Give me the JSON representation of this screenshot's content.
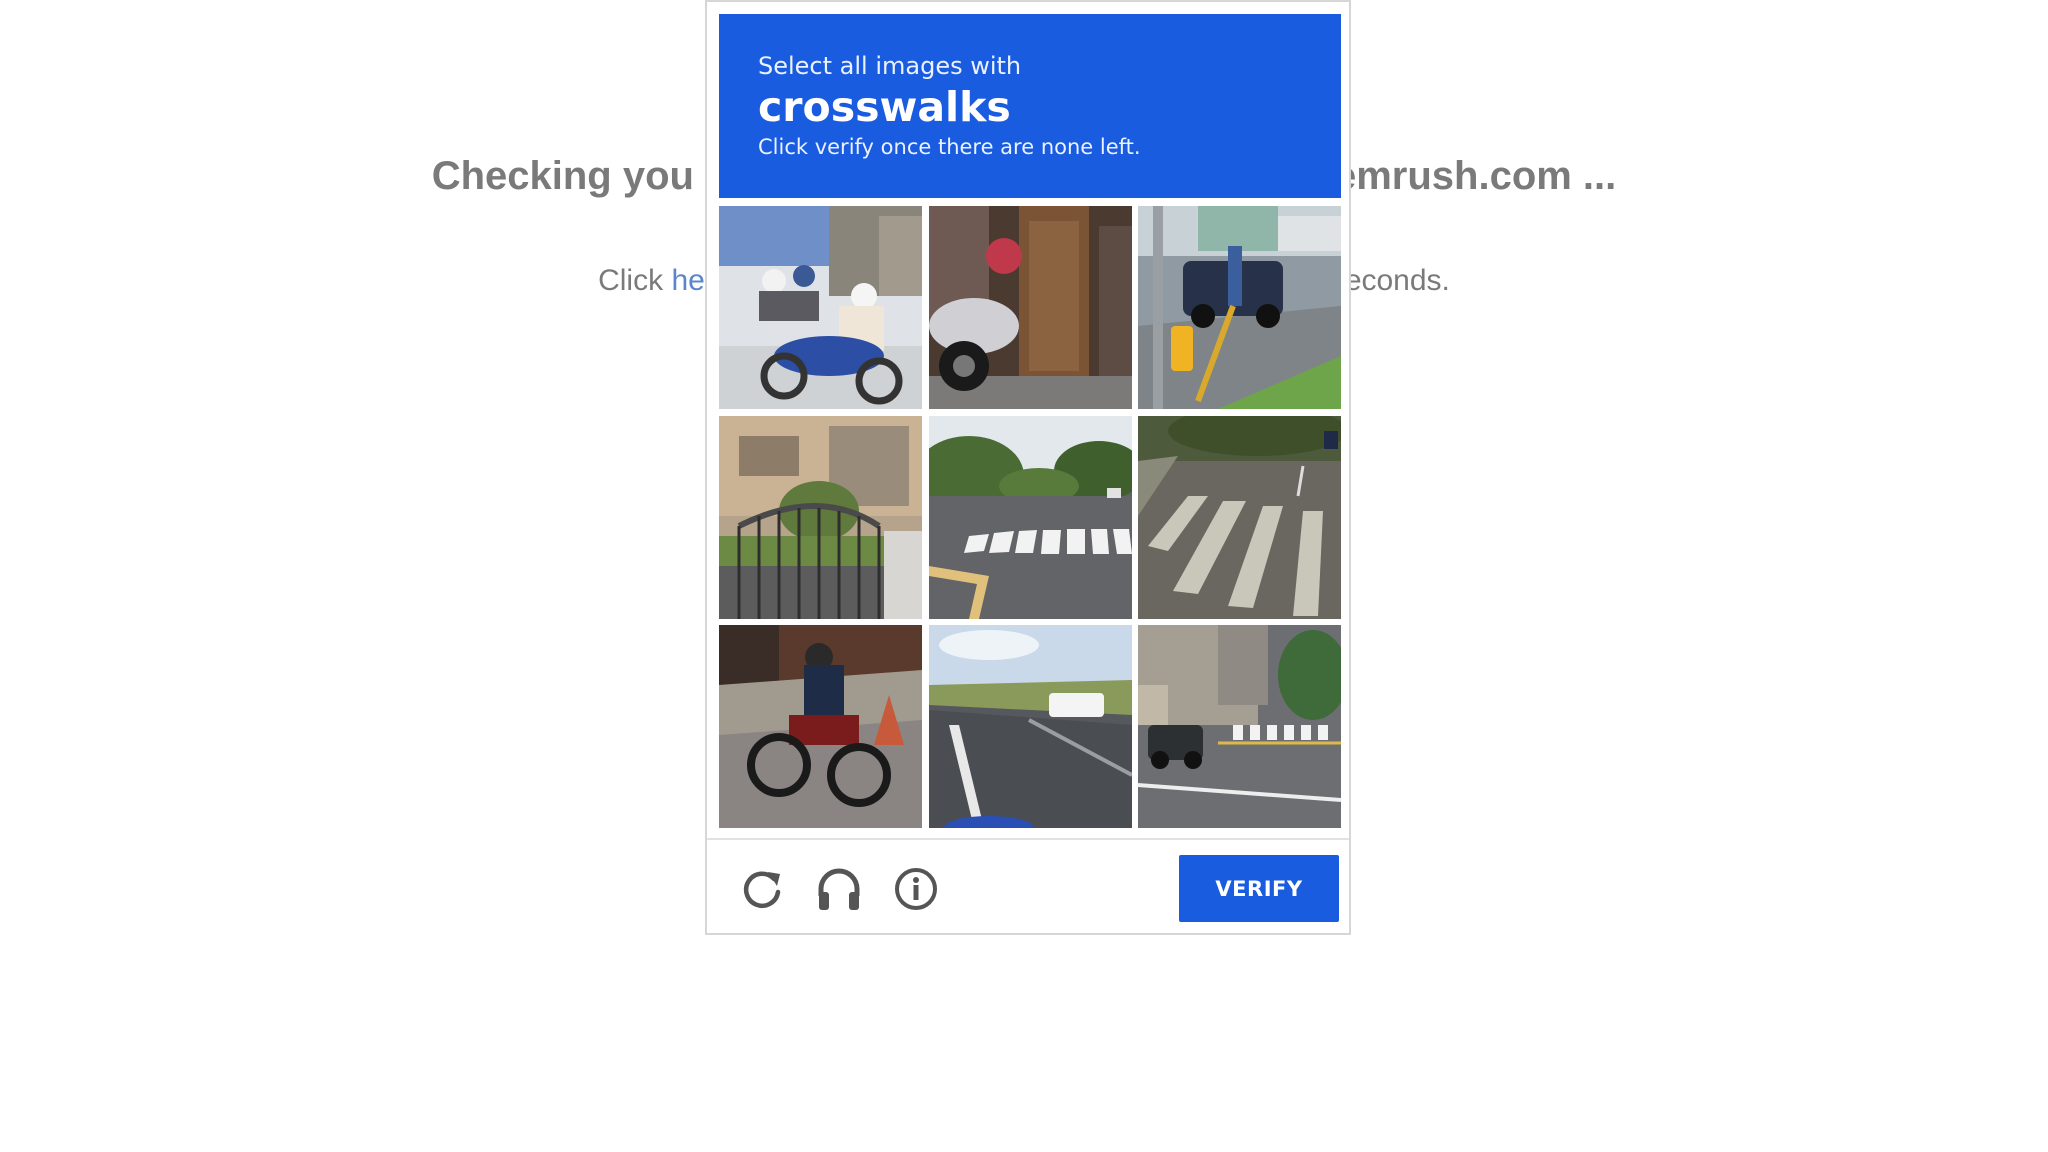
{
  "background": {
    "heading_left": "Checking you",
    "heading_right": "emrush.com ...",
    "sub_prefix": "Click ",
    "sub_link": "he",
    "sub_suffix": "econds."
  },
  "captcha": {
    "instruction": "Select all images with",
    "target": "crosswalks",
    "hint": "Click verify once there are none left.",
    "verify_label": "VERIFY",
    "accent_color": "#1a5ce0",
    "tiles": [
      {
        "name": "tile-motorbike-riders"
      },
      {
        "name": "tile-scooter-doorway"
      },
      {
        "name": "tile-street-car-hydrant"
      },
      {
        "name": "tile-building-gate"
      },
      {
        "name": "tile-road-crosswalk"
      },
      {
        "name": "tile-wide-crosswalk"
      },
      {
        "name": "tile-motorcycle-rider"
      },
      {
        "name": "tile-highway-bus"
      },
      {
        "name": "tile-intersection-crosswalk"
      }
    ],
    "icons": [
      "reload-icon",
      "headphones-icon",
      "info-icon"
    ]
  }
}
